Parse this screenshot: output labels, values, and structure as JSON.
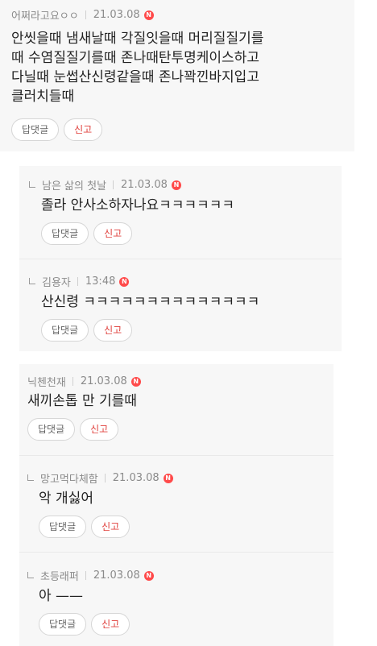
{
  "comments": [
    {
      "author": "어쩌라고요ㅇㅇ",
      "date": "21.03.08",
      "is_reply": false,
      "lines": [
        "안씻을때 냄새날때 각질잇을때 머리질질기를",
        "때 수염질질기를때 존나때탄투명케이스하고",
        "다닐때 눈썹산신령같을때 존나꽉낀바지입고",
        "클러치들때"
      ],
      "reply_label": "답댓글",
      "report_label": "신고",
      "new_badge": "N"
    },
    {
      "author": "남은 삶의 첫날",
      "date": "21.03.08",
      "is_reply": true,
      "lines": [
        "졸라 안사소하자나요ㅋㅋㅋㅋㅋㅋ"
      ],
      "reply_label": "답댓글",
      "report_label": "신고",
      "new_badge": "N"
    },
    {
      "author": "김용자",
      "date": "13:48",
      "is_reply": true,
      "lines": [
        "산신령 ㅋㅋㅋㅋㅋㅋㅋㅋㅋㅋㅋㅋㅋㅋ"
      ],
      "reply_label": "답댓글",
      "report_label": "신고",
      "new_badge": "N"
    },
    {
      "author": "닉첸천재",
      "date": "21.03.08",
      "is_reply": false,
      "lines": [
        "새끼손톱 만 기를때"
      ],
      "reply_label": "답댓글",
      "report_label": "신고",
      "new_badge": "N"
    },
    {
      "author": "망고먹다체함",
      "date": "21.03.08",
      "is_reply": true,
      "lines": [
        "악 개싫어"
      ],
      "reply_label": "답댓글",
      "report_label": "신고",
      "new_badge": "N"
    },
    {
      "author": "초등래퍼",
      "date": "21.03.08",
      "is_reply": true,
      "lines": [
        "아 ——"
      ],
      "reply_label": "답댓글",
      "report_label": "신고",
      "new_badge": "N"
    }
  ],
  "colors": {
    "card_bg": "#f7f7f7",
    "report_text": "#e0403c",
    "new_badge": "#ff4a4a"
  }
}
